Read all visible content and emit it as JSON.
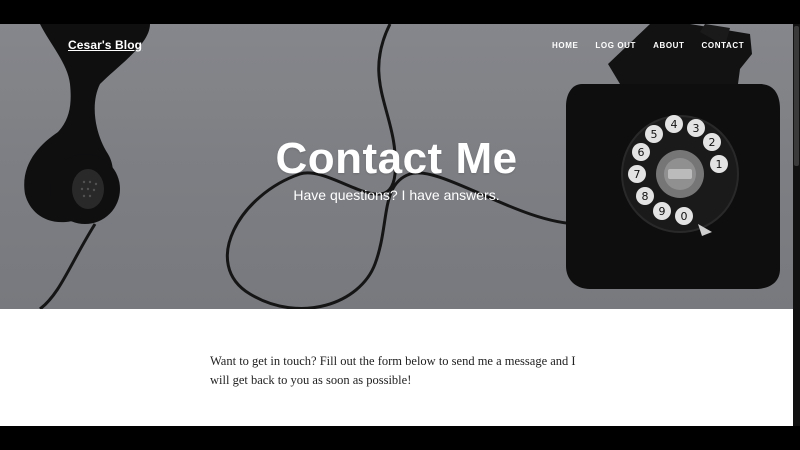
{
  "brand": {
    "name": "Cesar's Blog"
  },
  "nav": {
    "items": [
      {
        "label": "HOME"
      },
      {
        "label": "LOG OUT"
      },
      {
        "label": "ABOUT"
      },
      {
        "label": "CONTACT"
      }
    ]
  },
  "hero": {
    "title": "Contact Me",
    "subtitle": "Have questions? I have answers."
  },
  "content": {
    "intro": "Want to get in touch? Fill out the form below to send me a message and I will get back to you as soon as possible!"
  },
  "dial": {
    "digits": [
      "1",
      "2",
      "3",
      "4",
      "5",
      "6",
      "7",
      "8",
      "9",
      "0"
    ]
  }
}
